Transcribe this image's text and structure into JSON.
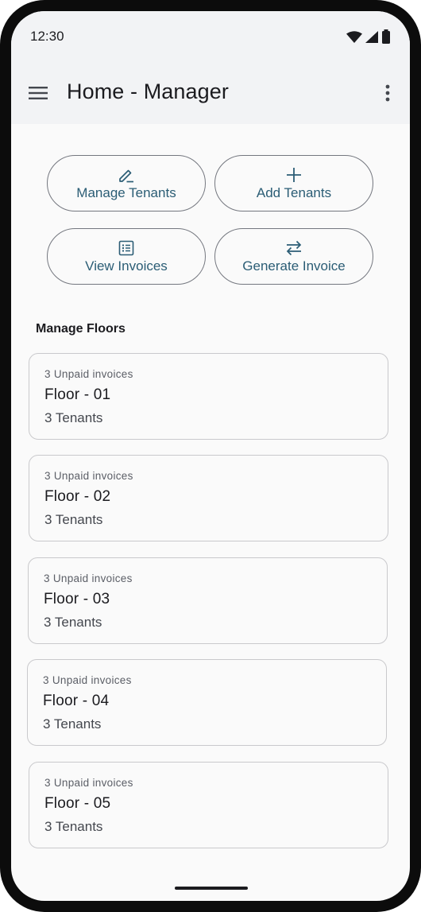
{
  "status_bar": {
    "time": "12:30",
    "icons": [
      "wifi-icon",
      "signal-icon",
      "battery-icon"
    ]
  },
  "app_bar": {
    "menu_icon": "hamburger-menu-icon",
    "title": "Home - Manager",
    "overflow_icon": "more-vert-icon"
  },
  "actions": [
    {
      "label": "Manage Tenants",
      "icon": "edit-pencil-icon"
    },
    {
      "label": "Add Tenants",
      "icon": "plus-icon"
    },
    {
      "label": "View Invoices",
      "icon": "list-icon"
    },
    {
      "label": "Generate Invoice",
      "icon": "swap-arrows-icon"
    }
  ],
  "floors_section": {
    "title": "Manage Floors",
    "floors": [
      {
        "unpaid": "3 Unpaid invoices",
        "name": "Floor - 01",
        "tenants": "3 Tenants"
      },
      {
        "unpaid": "3 Unpaid invoices",
        "name": "Floor - 02",
        "tenants": "3 Tenants"
      },
      {
        "unpaid": "3 Unpaid invoices",
        "name": "Floor - 03",
        "tenants": "3 Tenants"
      },
      {
        "unpaid": "3 Unpaid invoices",
        "name": "Floor - 04",
        "tenants": "3 Tenants"
      },
      {
        "unpaid": "3 Unpaid invoices",
        "name": "Floor - 05",
        "tenants": "3 Tenants"
      }
    ]
  },
  "colors": {
    "accent": "#2b5d75",
    "app_bar_bg": "#f2f3f5",
    "outline": "#74777f",
    "card_border": "#c9c9cc",
    "background": "#fafafa"
  }
}
